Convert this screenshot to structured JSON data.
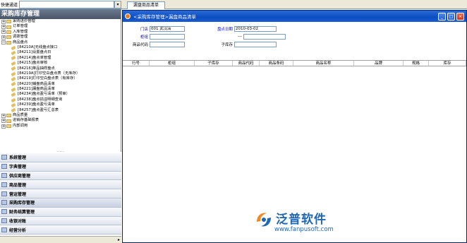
{
  "left_search": {
    "label": "快捷通道",
    "dropdown_icon": "chevron-down-icon"
  },
  "left_panel": {
    "title": "采购库存管理",
    "tree": [
      {
        "kind": "folder",
        "text": "采购进价管理"
      },
      {
        "kind": "folder",
        "text": "订单管理"
      },
      {
        "kind": "folder",
        "text": "入库管理"
      },
      {
        "kind": "folder",
        "text": "调拨管理"
      },
      {
        "kind": "folder-open",
        "text": "商品盘点"
      },
      {
        "kind": "leaf",
        "text": "[84210A]无线盘点接口"
      },
      {
        "kind": "leaf",
        "text": "[84211]设置盘点日"
      },
      {
        "kind": "leaf",
        "text": "[84214]盘点单管理"
      },
      {
        "kind": "leaf",
        "text": "[84215]盘点审核"
      },
      {
        "kind": "leaf",
        "text": "[84216]单品抽样盘点"
      },
      {
        "kind": "leaf",
        "text": "[84219A]打印空白盘点表（无库存）"
      },
      {
        "kind": "leaf",
        "text": "[84219]打印空白盘点表（有库存）"
      },
      {
        "kind": "leaf",
        "text": "[84220]铺盘商品清单"
      },
      {
        "kind": "leaf",
        "text": "[84221]漏盘商品清单"
      },
      {
        "kind": "leaf",
        "text": "[84234]盘点盈亏清单（预审）"
      },
      {
        "kind": "leaf",
        "text": "[84238]盘点损溢明细查询"
      },
      {
        "kind": "leaf",
        "text": "[84239]盘点盈亏清单"
      },
      {
        "kind": "leaf",
        "text": "[84257]盘点盈亏汇总表"
      },
      {
        "kind": "folder",
        "text": "商品质量"
      },
      {
        "kind": "folder",
        "text": "进销存基础报表"
      },
      {
        "kind": "folder",
        "text": "内部调用"
      }
    ],
    "splitter": "........"
  },
  "modules": [
    {
      "name": "module-system",
      "label": "系统管理"
    },
    {
      "name": "module-dictionary",
      "label": "字典管理"
    },
    {
      "name": "module-supplier",
      "label": "供应商管理"
    },
    {
      "name": "module-goods",
      "label": "商品管理"
    },
    {
      "name": "module-logistics",
      "label": "营运管理"
    },
    {
      "name": "module-purchase-inventory",
      "label": "采购库存管理"
    },
    {
      "name": "module-finance",
      "label": "财务结算管理"
    },
    {
      "name": "module-cashier",
      "label": "收银对账"
    },
    {
      "name": "module-analysis",
      "label": "经营分析"
    }
  ],
  "tab": {
    "label": "漏盘商品清单"
  },
  "window": {
    "title": "<采购库存管理>漏盘商品清单",
    "buttons": {
      "min": "_",
      "max": "□",
      "close": "×"
    }
  },
  "form": {
    "store_label": "门店",
    "store_value": "001 武汉店",
    "date_label": "盘点日期",
    "date_value": "2010-03-02",
    "counter_label": "柜组",
    "dash": "---",
    "code_label": "商品代码",
    "subwh_label": "子库存"
  },
  "grid": {
    "columns": [
      "行号",
      "柜组",
      "子库存",
      "商品代码",
      "商品条码",
      "商品名称",
      "品牌",
      "规格",
      "库存"
    ]
  },
  "watermark": {
    "brand": "泛普软件",
    "url": "www.fanpusoft.com",
    "color": "#1f67b3"
  }
}
